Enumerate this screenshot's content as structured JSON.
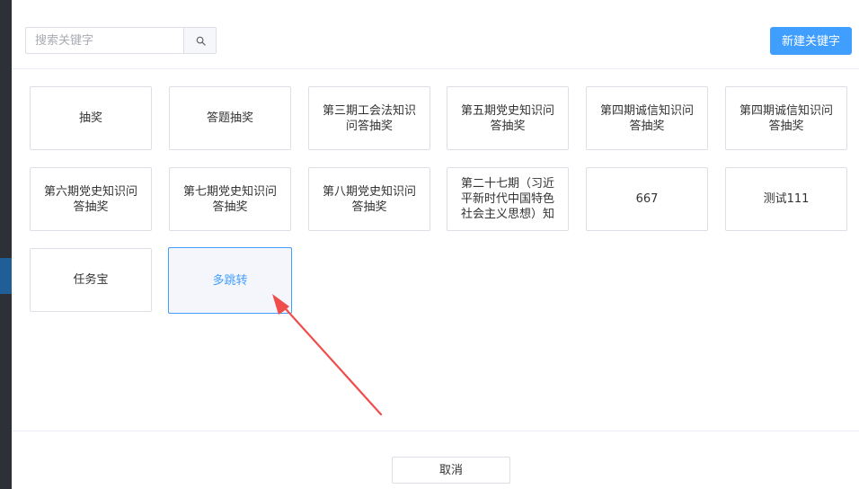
{
  "search": {
    "placeholder": "搜索关键字",
    "value": "",
    "icon": "search-icon"
  },
  "toolbar": {
    "new_label": "新建关键字"
  },
  "cards": [
    {
      "label": "抽奖",
      "selected": false
    },
    {
      "label": "答题抽奖",
      "selected": false
    },
    {
      "label": "第三期工会法知识问答抽奖",
      "selected": false
    },
    {
      "label": "第五期党史知识问答抽奖",
      "selected": false
    },
    {
      "label": "第四期诚信知识问答抽奖",
      "selected": false
    },
    {
      "label": "第四期诚信知识问答抽奖",
      "selected": false
    },
    {
      "label": "第六期党史知识问答抽奖",
      "selected": false
    },
    {
      "label": "第七期党史知识问答抽奖",
      "selected": false
    },
    {
      "label": "第八期党史知识问答抽奖",
      "selected": false
    },
    {
      "label": "第二十七期（习近平新时代中国特色社会主义思想）知",
      "selected": false
    },
    {
      "label": "667",
      "selected": false
    },
    {
      "label": "测试111",
      "selected": false
    },
    {
      "label": "任务宝",
      "selected": false
    },
    {
      "label": "多跳转",
      "selected": true
    }
  ],
  "footer": {
    "cancel_label": "取消"
  },
  "colors": {
    "accent": "#409eff",
    "annotation_arrow": "#f04d4d",
    "selected_card_bg": "#f4f6fb"
  }
}
